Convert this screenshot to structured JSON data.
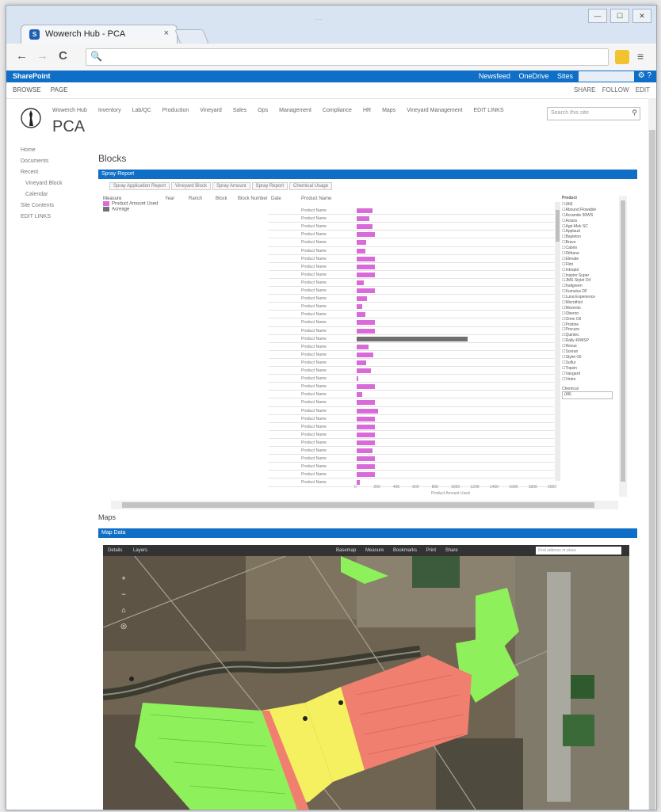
{
  "browser": {
    "tab_title": "Wowerch Hub - PCA",
    "tab_close": "×",
    "window_title": "...",
    "window_buttons": [
      "—",
      "☐",
      "✕"
    ],
    "back": "←",
    "forward": "→",
    "reload": "C",
    "search_glyph": "🔍",
    "menu_glyph": "≡"
  },
  "sharepoint": {
    "brand": "SharePoint",
    "suite_links": [
      "Newsfeed",
      "OneDrive",
      "Sites"
    ],
    "user": "",
    "ribbon_tabs": [
      "BROWSE",
      "PAGE"
    ],
    "ribbon_actions": [
      "SHARE",
      "FOLLOW",
      "EDIT"
    ],
    "top_nav": [
      "Wowerch Hub",
      "Inventory",
      "Lab/QC",
      "Production",
      "Vineyard",
      "Sales",
      "Ops",
      "Management",
      "Compliance",
      "HR",
      "Maps",
      "Vineyard Management",
      "EDIT LINKS"
    ],
    "site_title": "PCA",
    "search_placeholder": "Search this site",
    "left_nav": [
      "Home",
      "Documents",
      "Recent",
      "Vineyard Block",
      "Calendar",
      "Site Contents",
      "EDIT LINKS"
    ]
  },
  "sections": {
    "report_heading": "Blocks",
    "report_bar": "Spray Report",
    "report_tabs": [
      "Spray Application Report",
      "Vineyard Block",
      "Spray Amount",
      "Spray Report",
      "Chemical Usage"
    ],
    "map_heading": "Maps",
    "map_bar": "Map Data"
  },
  "report": {
    "legend_title": "Measure",
    "legend": [
      {
        "label": "Product Amount Used",
        "color": "#d86bd8"
      },
      {
        "label": "Acreage",
        "color": "#707070"
      }
    ],
    "columns": [
      "Year",
      "Ranch",
      "Block",
      "Block Number",
      "Date",
      "Product Name"
    ],
    "row_label": "Product Name",
    "axis_title": "Product Amount Used",
    "axis_ticks": [
      "0",
      "200",
      "400",
      "600",
      "800",
      "1000",
      "1200",
      "1400",
      "1600",
      "1800",
      "2000"
    ]
  },
  "chart_data": {
    "type": "bar",
    "orientation": "horizontal",
    "xlim": [
      0,
      2000
    ],
    "series": [
      {
        "name": "Product Amount Used",
        "color": "#d86bd8",
        "values": [
          160,
          130,
          160,
          190,
          100,
          90,
          190,
          190,
          190,
          70,
          190,
          110,
          60,
          90,
          190,
          190
        ]
      },
      {
        "name": "Acreage",
        "color": "#707070",
        "values": [
          1150
        ]
      },
      {
        "name": "Product Amount Used",
        "color": "#d86bd8",
        "values": [
          120,
          170,
          100,
          150,
          20,
          190,
          60,
          190,
          220,
          190,
          190,
          190,
          190,
          160,
          190,
          190,
          190,
          30
        ]
      }
    ]
  },
  "filter": {
    "title": "Product",
    "items": [
      "(All)",
      "Abound Flowable",
      "Acramite 50WS",
      "Actara",
      "Agri-Mek SC",
      "Applaud",
      "Bayleton",
      "Bravo",
      "Cabrio",
      "Dithane",
      "Elevate",
      "Flint",
      "Intrepid",
      "Inspire Super",
      "JMS Stylet Oil",
      "Kaligreen",
      "Kumulus DF",
      "Luna Experience",
      "Microthiol",
      "Movento",
      "Oberon",
      "Omni Oil",
      "Pristine",
      "Procure",
      "Quintec",
      "Rally 40WSP",
      "Revus",
      "Sovran",
      "Stylet Oil",
      "Sulfur",
      "Topsin",
      "Vangard",
      "Vintre"
    ],
    "select_label": "Chemical",
    "select_value": "(All)"
  },
  "map": {
    "toolbar_left": [
      "Details",
      "Layers"
    ],
    "toolbar_right": [
      "Basemap",
      "Measure",
      "Bookmarks",
      "Print",
      "Share"
    ],
    "search_placeholder": "Find address or place",
    "zoom_in": "+",
    "zoom_out": "−",
    "home": "⌂",
    "locate": "◎",
    "colors": {
      "green": "#8ef05a",
      "red": "#f07f70",
      "yellow": "#f4f060"
    }
  }
}
